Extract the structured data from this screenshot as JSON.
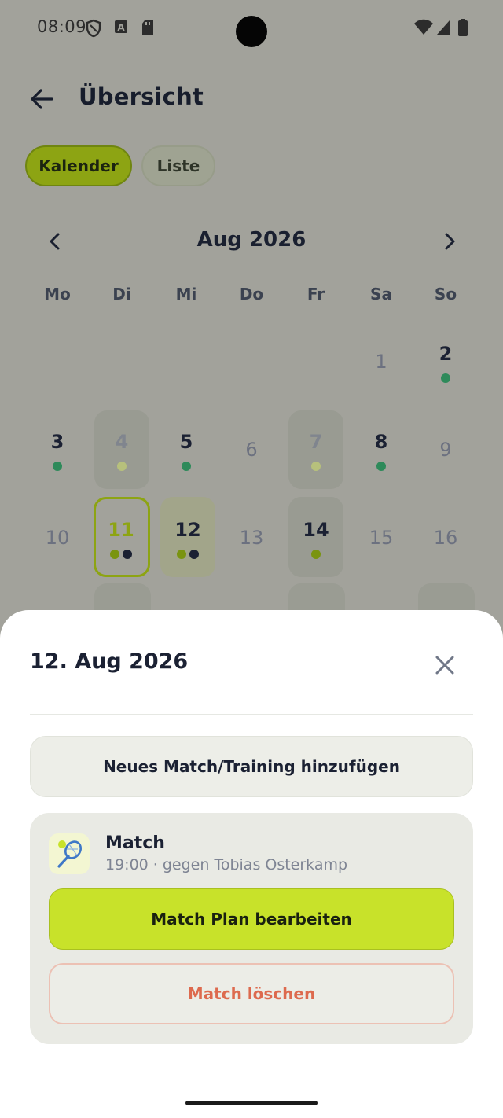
{
  "status_bar": {
    "time": "08:09",
    "icons": [
      "shield-icon",
      "font-a-icon",
      "sd-card-icon",
      "wifi-icon",
      "signal-icon",
      "battery-icon"
    ]
  },
  "app_bar": {
    "back_icon": "arrow-left-icon",
    "title": "Übersicht"
  },
  "view_toggle": {
    "options": [
      {
        "label": "Kalender",
        "selected": true
      },
      {
        "label": "Liste",
        "selected": false
      }
    ]
  },
  "calendar": {
    "month_label": "Aug 2026",
    "prev_icon": "chevron-left-icon",
    "next_icon": "chevron-right-icon",
    "weekdays": [
      "Mo",
      "Di",
      "Mi",
      "Do",
      "Fr",
      "Sa",
      "So"
    ],
    "days": [
      "1",
      "2",
      "3",
      "4",
      "5",
      "6",
      "7",
      "8",
      "9",
      "10",
      "11",
      "12",
      "13",
      "14",
      "15",
      "16"
    ],
    "selected_day": "11",
    "highlighted_day": "12"
  },
  "sheet": {
    "title": "12. Aug 2026",
    "close_icon": "close-icon",
    "add_button": "Neues Match/Training hinzufügen",
    "event": {
      "icon": "tennis-racket-icon",
      "title": "Match",
      "subtitle": "19:00  ·  gegen Tobias Osterkamp",
      "edit_button": "Match Plan bearbeiten",
      "delete_button": "Match löschen"
    }
  },
  "colors": {
    "accent_lime": "#c8e22a",
    "dot_green": "#2e8a5a",
    "dot_dark": "#1b2133",
    "danger": "#dd6a4e",
    "scrim": "#a2a29b"
  }
}
